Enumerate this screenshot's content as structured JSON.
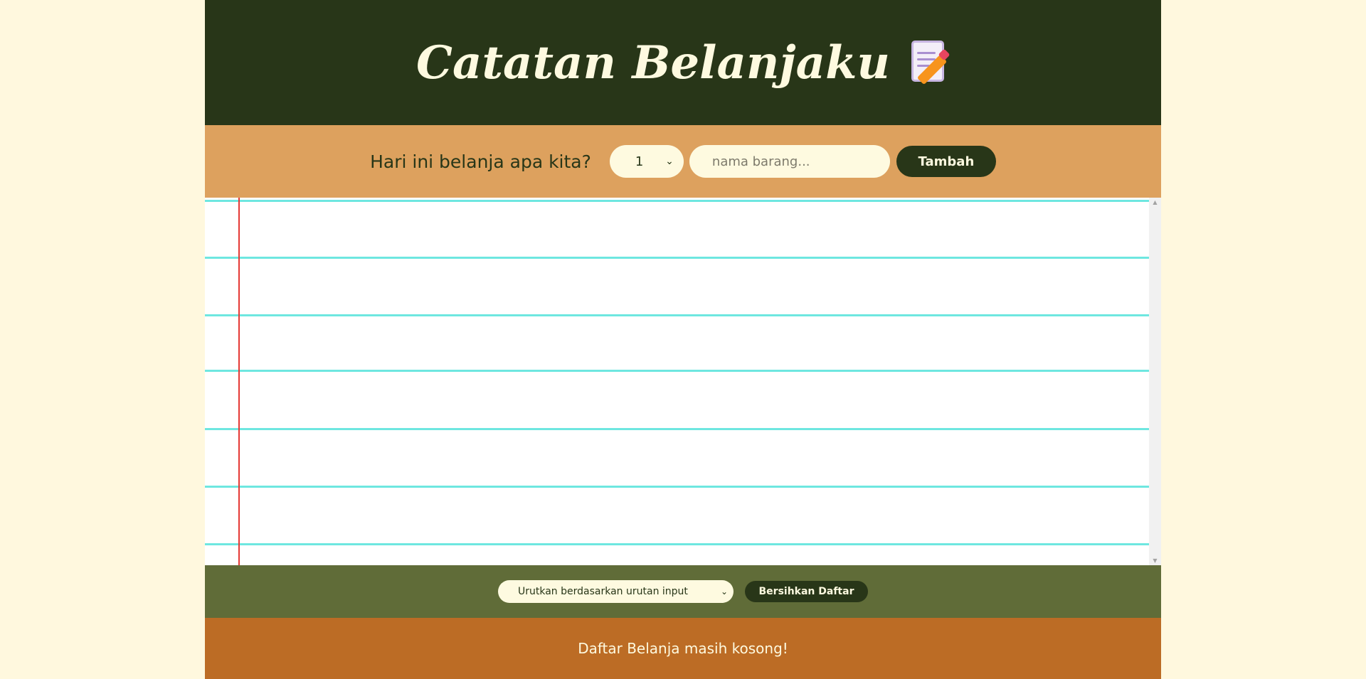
{
  "header": {
    "title": "Catatan Belanjaku",
    "icon": "memo-icon"
  },
  "form": {
    "prompt": "Hari ini belanja apa kita?",
    "quantity_value": "1",
    "name_placeholder": "nama barang...",
    "add_label": "Tambah"
  },
  "actions": {
    "sort_value": "Urutkan berdasarkan urutan input",
    "clear_label": "Bersihkan Daftar"
  },
  "footer": {
    "status": "Daftar Belanja masih kosong!"
  },
  "colors": {
    "page_bg": "#fff8de",
    "header_bg": "#283618",
    "form_bg": "#dda15e",
    "action_bg": "#606c38",
    "footer_bg": "#bc6c25",
    "rule_line": "#6ee7e0",
    "margin_line": "#e53935"
  }
}
